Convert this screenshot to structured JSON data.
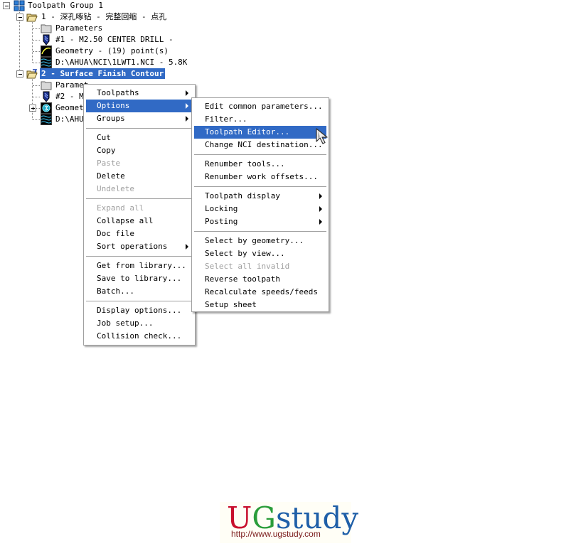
{
  "tree": {
    "root": "Toolpath Group 1",
    "op1": {
      "title": "1 - 深孔啄钻 - 完整回缩 - 点孔",
      "parameters": "Parameters",
      "tool": "#1 - M2.50 CENTER DRILL -",
      "geometry": "Geometry - (19) point(s)",
      "nci": "D:\\AHUA\\NCI\\1LWT1.NCI - 5.8K"
    },
    "op2": {
      "title": "2 - Surface Finish Contour",
      "parameters": "Paramet",
      "tool": "#2 - M1",
      "geometry": "Geometr",
      "nci": "D:\\AHUA"
    }
  },
  "context_menu": {
    "items": [
      {
        "label": "Toolpaths",
        "submenu": true
      },
      {
        "label": "Options",
        "submenu": true,
        "highlighted": true
      },
      {
        "label": "Groups",
        "submenu": true
      },
      {
        "label": "Cut"
      },
      {
        "label": "Copy"
      },
      {
        "label": "Paste",
        "disabled": true
      },
      {
        "label": "Delete"
      },
      {
        "label": "Undelete",
        "disabled": true
      },
      {
        "label": "Expand all",
        "disabled": true
      },
      {
        "label": "Collapse all"
      },
      {
        "label": "Doc file"
      },
      {
        "label": "Sort operations",
        "submenu": true
      },
      {
        "label": "Get from library..."
      },
      {
        "label": "Save to library..."
      },
      {
        "label": "Batch..."
      },
      {
        "label": "Display options..."
      },
      {
        "label": "Job setup..."
      },
      {
        "label": "Collision check..."
      }
    ]
  },
  "options_submenu": {
    "items": [
      {
        "label": "Edit common parameters..."
      },
      {
        "label": "Filter..."
      },
      {
        "label": "Toolpath Editor...",
        "highlighted": true
      },
      {
        "label": "Change NCI destination..."
      },
      {
        "label": "Renumber tools..."
      },
      {
        "label": "Renumber work offsets..."
      },
      {
        "label": "Toolpath display",
        "submenu": true
      },
      {
        "label": "Locking",
        "submenu": true
      },
      {
        "label": "Posting",
        "submenu": true
      },
      {
        "label": "Select by geometry..."
      },
      {
        "label": "Select by view..."
      },
      {
        "label": "Select all invalid",
        "disabled": true
      },
      {
        "label": "Reverse toolpath"
      },
      {
        "label": "Recalculate speeds/feeds"
      },
      {
        "label": "Setup sheet"
      }
    ]
  },
  "logo": {
    "text_u": "U",
    "text_g": "G",
    "text_study": "study",
    "url": "http://www.ugstudy.com"
  },
  "colors": {
    "selection": "#316ac5",
    "logo_u": "#c8102e",
    "logo_g": "#2a9d3a",
    "logo_study": "#1f5fa8"
  }
}
